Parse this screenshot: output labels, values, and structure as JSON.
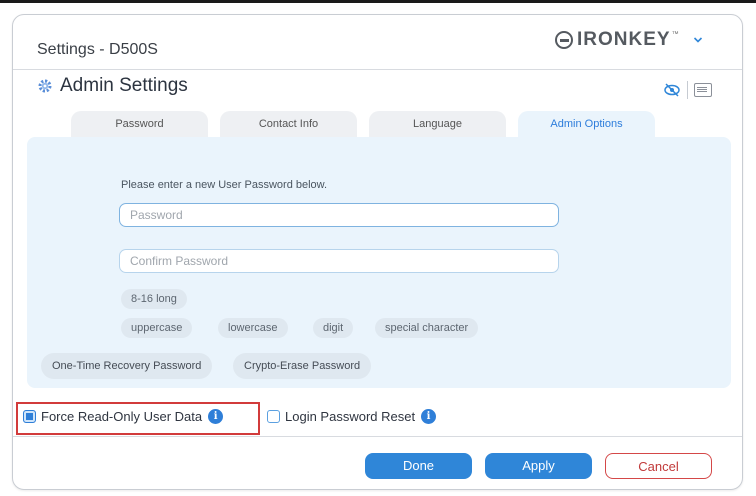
{
  "window": {
    "title": "Settings - D500S",
    "brand": "IRONKEY",
    "brand_tm": "™"
  },
  "section": {
    "title": "Admin Settings"
  },
  "tabs": [
    {
      "label": "Password",
      "active": false
    },
    {
      "label": "Contact Info",
      "active": false
    },
    {
      "label": "Language",
      "active": false
    },
    {
      "label": "Admin Options",
      "active": true
    }
  ],
  "form": {
    "prompt": "Please enter a new User Password below.",
    "password_placeholder": "Password",
    "confirm_placeholder": "Confirm Password",
    "requirements": [
      "8-16 long",
      "uppercase",
      "lowercase",
      "digit",
      "special character"
    ]
  },
  "options": {
    "recovery_button": "One-Time Recovery Password",
    "crypto_erase_button": "Crypto-Erase Password"
  },
  "checkboxes": {
    "force_read_only": {
      "label": "Force Read-Only User Data",
      "checked": true
    },
    "login_password_reset": {
      "label": "Login Password Reset",
      "checked": false
    }
  },
  "actions": {
    "done": "Done",
    "apply": "Apply",
    "cancel": "Cancel"
  },
  "icons": {
    "info_glyph": "i"
  },
  "colors": {
    "accent": "#2f86d8",
    "panel_bg": "#eaf4fc",
    "cancel": "#d44848",
    "highlight": "#d23b3b"
  }
}
